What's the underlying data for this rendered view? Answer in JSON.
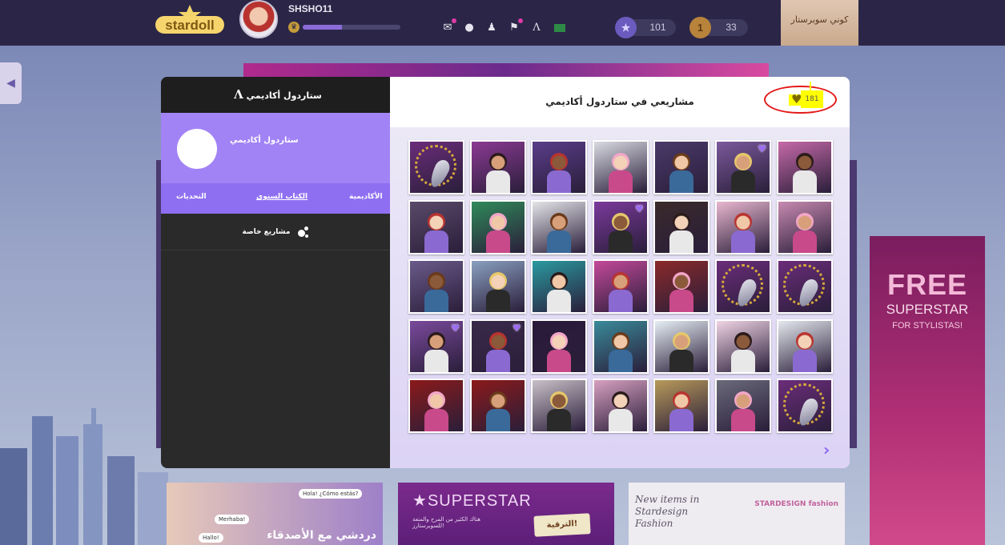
{
  "topbar": {
    "logo_text": "stardoll",
    "username": "SHSHO11",
    "xp_progress": 0.4,
    "icons": [
      "bell-icon",
      "chat-icon",
      "friends-icon",
      "bookmark-icon",
      "academy-icon",
      "flag-icon"
    ],
    "stardollars": "101",
    "starcoins": "33",
    "superstar_button": "كوني سوبرستار"
  },
  "sidebar": {
    "header": "ستاردول أكاديمي",
    "profile_name": "ستاردول أكاديمي",
    "tabs": [
      {
        "label": "الأكاديمية",
        "active": false
      },
      {
        "label": "الكتاب السنوي",
        "active": true
      },
      {
        "label": "التحديات",
        "active": false
      }
    ],
    "item_label": "مشاريع خاصة"
  },
  "content": {
    "title": "مشاريعي في ستاردول أكاديمي",
    "likes": "181"
  },
  "projects": [
    {
      "theme": "jewelry",
      "bg": "#6b2d7a",
      "heart": false
    },
    {
      "theme": "makeup",
      "bg": "#8b3a93",
      "heart": false
    },
    {
      "theme": "hair",
      "bg": "#5a3d8a",
      "heart": false
    },
    {
      "theme": "girl-denim",
      "bg": "#d9dbe2",
      "heart": false
    },
    {
      "theme": "boots",
      "bg": "#4a3a6a",
      "heart": false
    },
    {
      "theme": "portrait",
      "bg": "#7b5a9c",
      "heart": true
    },
    {
      "theme": "pink-dress",
      "bg": "#c66aa8",
      "heart": false
    },
    {
      "theme": "girl-stripes",
      "bg": "#5a4a6a",
      "heart": false
    },
    {
      "theme": "soccer",
      "bg": "#2f8a5a",
      "heart": false
    },
    {
      "theme": "glasses-girl",
      "bg": "#e4e4e8",
      "heart": false
    },
    {
      "theme": "lipstick",
      "bg": "#7b3a9c",
      "heart": true
    },
    {
      "theme": "brunette",
      "bg": "#3a2a2a",
      "heart": false
    },
    {
      "theme": "eyes",
      "bg": "#e9b7cf",
      "heart": false
    },
    {
      "theme": "mannequins",
      "bg": "#c78ab0",
      "heart": false
    },
    {
      "theme": "three-girls",
      "bg": "#6a5a8a",
      "heart": false
    },
    {
      "theme": "paris",
      "bg": "#8aa0c0",
      "heart": false
    },
    {
      "theme": "tropical",
      "bg": "#2a9aa0",
      "heart": false
    },
    {
      "theme": "shopping",
      "bg": "#c44a9a",
      "heart": false
    },
    {
      "theme": "redhead",
      "bg": "#8a2a2a",
      "heart": false
    },
    {
      "theme": "jewelry",
      "bg": "#6b2d7a",
      "heart": false
    },
    {
      "theme": "jewelry",
      "bg": "#6b2d7a",
      "heart": false
    },
    {
      "theme": "beauty-set",
      "bg": "#7a4a9c",
      "heart": true
    },
    {
      "theme": "cover",
      "bg": "#3a2a4a",
      "heart": true
    },
    {
      "theme": "mask",
      "bg": "#2a1a3a",
      "heart": false
    },
    {
      "theme": "blazer",
      "bg": "#3a8a9a",
      "heart": false
    },
    {
      "theme": "interior",
      "bg": "#e6eef4",
      "heart": false
    },
    {
      "theme": "pink-hair",
      "bg": "#f0d4e4",
      "heart": false
    },
    {
      "theme": "necklace",
      "bg": "#e4e8ee",
      "heart": false
    },
    {
      "theme": "red-curtain",
      "bg": "#8a1a1a",
      "heart": false
    },
    {
      "theme": "red-curtain",
      "bg": "#8a1a1a",
      "heart": false
    },
    {
      "theme": "blonde",
      "bg": "#c8c0c8",
      "heart": false
    },
    {
      "theme": "dark-hair",
      "bg": "#d7a0c0",
      "heart": false
    },
    {
      "theme": "london",
      "bg": "#b89a5a",
      "heart": false
    },
    {
      "theme": "runway",
      "bg": "#6a6a7a",
      "heart": false
    },
    {
      "theme": "jewelry",
      "bg": "#6b2d7a",
      "heart": false
    }
  ],
  "background": {
    "ad_free": "FREE",
    "ad_superstar": "SUPERSTAR",
    "ad_sub": "FOR STYLISTAS!",
    "chat_label": "دردشي مع الأصدقاء",
    "chat_bubbles": [
      "Hola! ¿Cómo estás?",
      "Merhaba!",
      "Hallo!"
    ],
    "superstar_card_title": "SUPERSTAR",
    "superstar_card_desc": "هناك الكثير من المرح والمتعة للسوبرستارز!",
    "superstar_upgrade": "الترقية!",
    "stardesign_title": "New items in Stardesign Fashion",
    "stardesign_logo": "STARDESIGN fashion"
  }
}
